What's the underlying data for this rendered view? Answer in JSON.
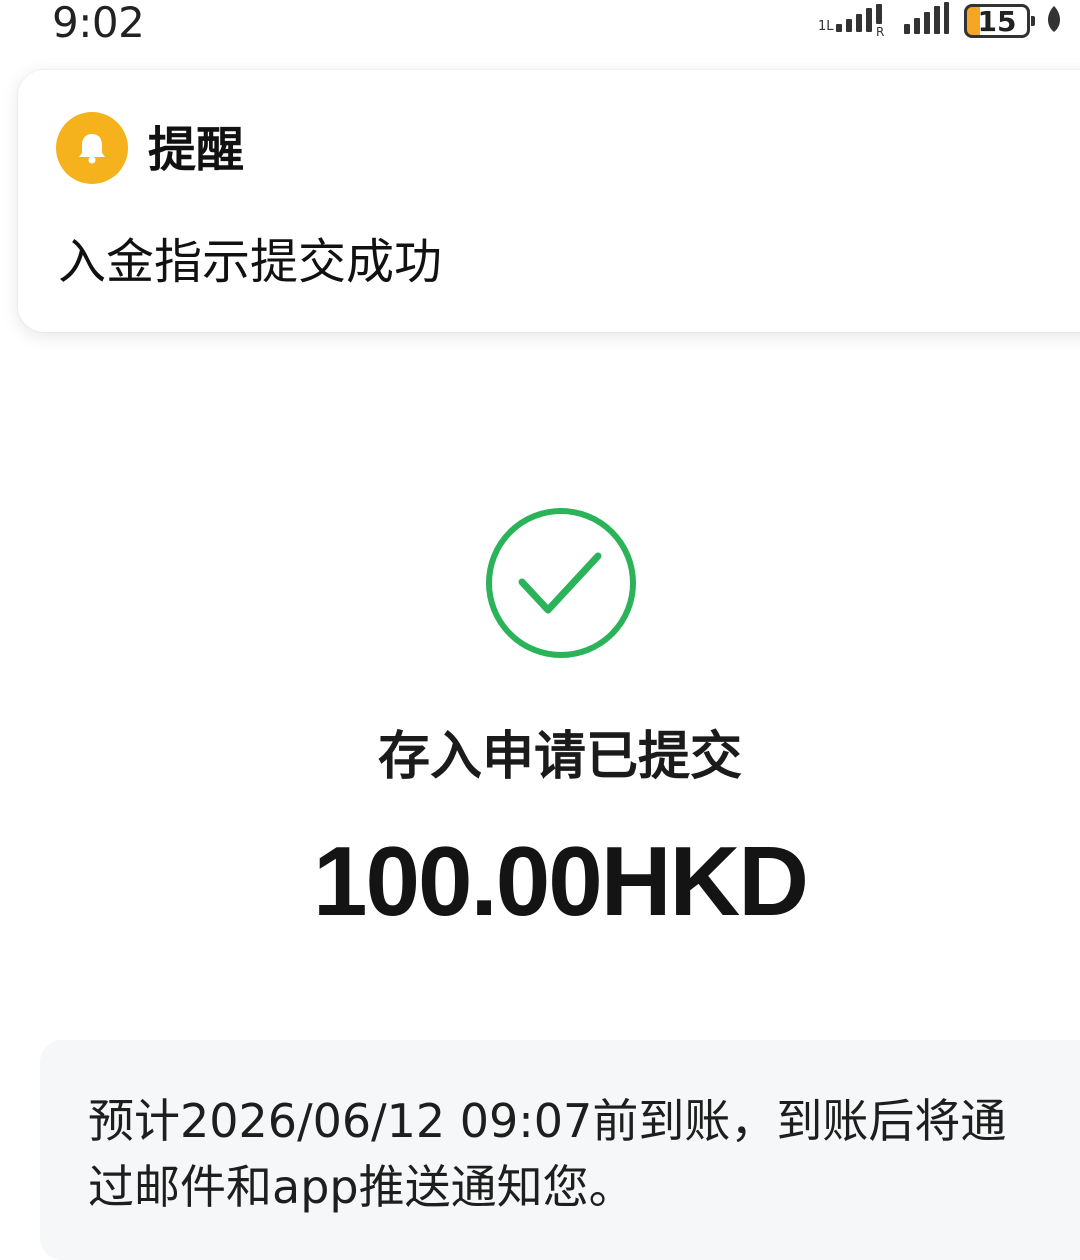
{
  "status_bar": {
    "time": "9:02",
    "battery_level": "15",
    "icons": [
      "signal-1-icon",
      "signal-2-icon",
      "battery-icon",
      "leaf-icon"
    ]
  },
  "notification": {
    "icon": "bell-icon",
    "icon_color": "#f5b21d",
    "title": "提醒",
    "body": "入金指示提交成功"
  },
  "result": {
    "icon": "check-circle-icon",
    "icon_color": "#2bb35a",
    "title": "存入申请已提交",
    "amount": "100.00HKD"
  },
  "info": {
    "text": "预计2026/06/12 09:07前到账，到账后将通过邮件和app推送通知您。"
  }
}
